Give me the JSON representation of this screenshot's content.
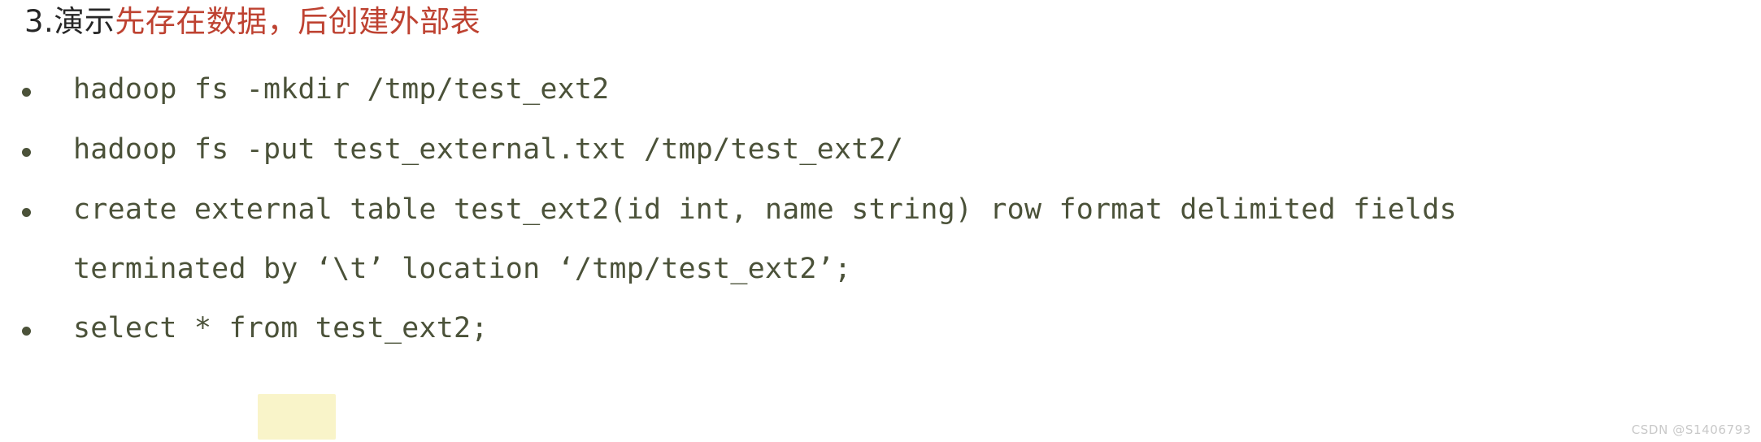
{
  "page": {
    "background_color": "#ffffff",
    "text_color": "#4b5239",
    "accent_red": "#be4231",
    "heading_black": "#262626",
    "highlight_color": "#f6f0b4"
  },
  "heading": {
    "number": "3.",
    "black_text": "演示",
    "red_text": "先存在数据，后创建外部表"
  },
  "bullets": [
    {
      "marker": "bullet-dot",
      "line1": "hadoop fs -mkdir /tmp/test_ext2",
      "line2": ""
    },
    {
      "marker": "bullet-dot",
      "line1": "hadoop fs -put test_external.txt /tmp/test_ext2/",
      "line2": ""
    },
    {
      "marker": "bullet-dot",
      "line1": "create external table test_ext2(id int, name string) row format delimited fields",
      "line2": "terminated by ‘\\t’ location ‘/tmp/test_ext2’;"
    },
    {
      "marker": "bullet-dot",
      "line1": "select * from test_ext2;",
      "line2": ""
    }
  ],
  "watermark": {
    "text": "CSDN @S1406793"
  }
}
